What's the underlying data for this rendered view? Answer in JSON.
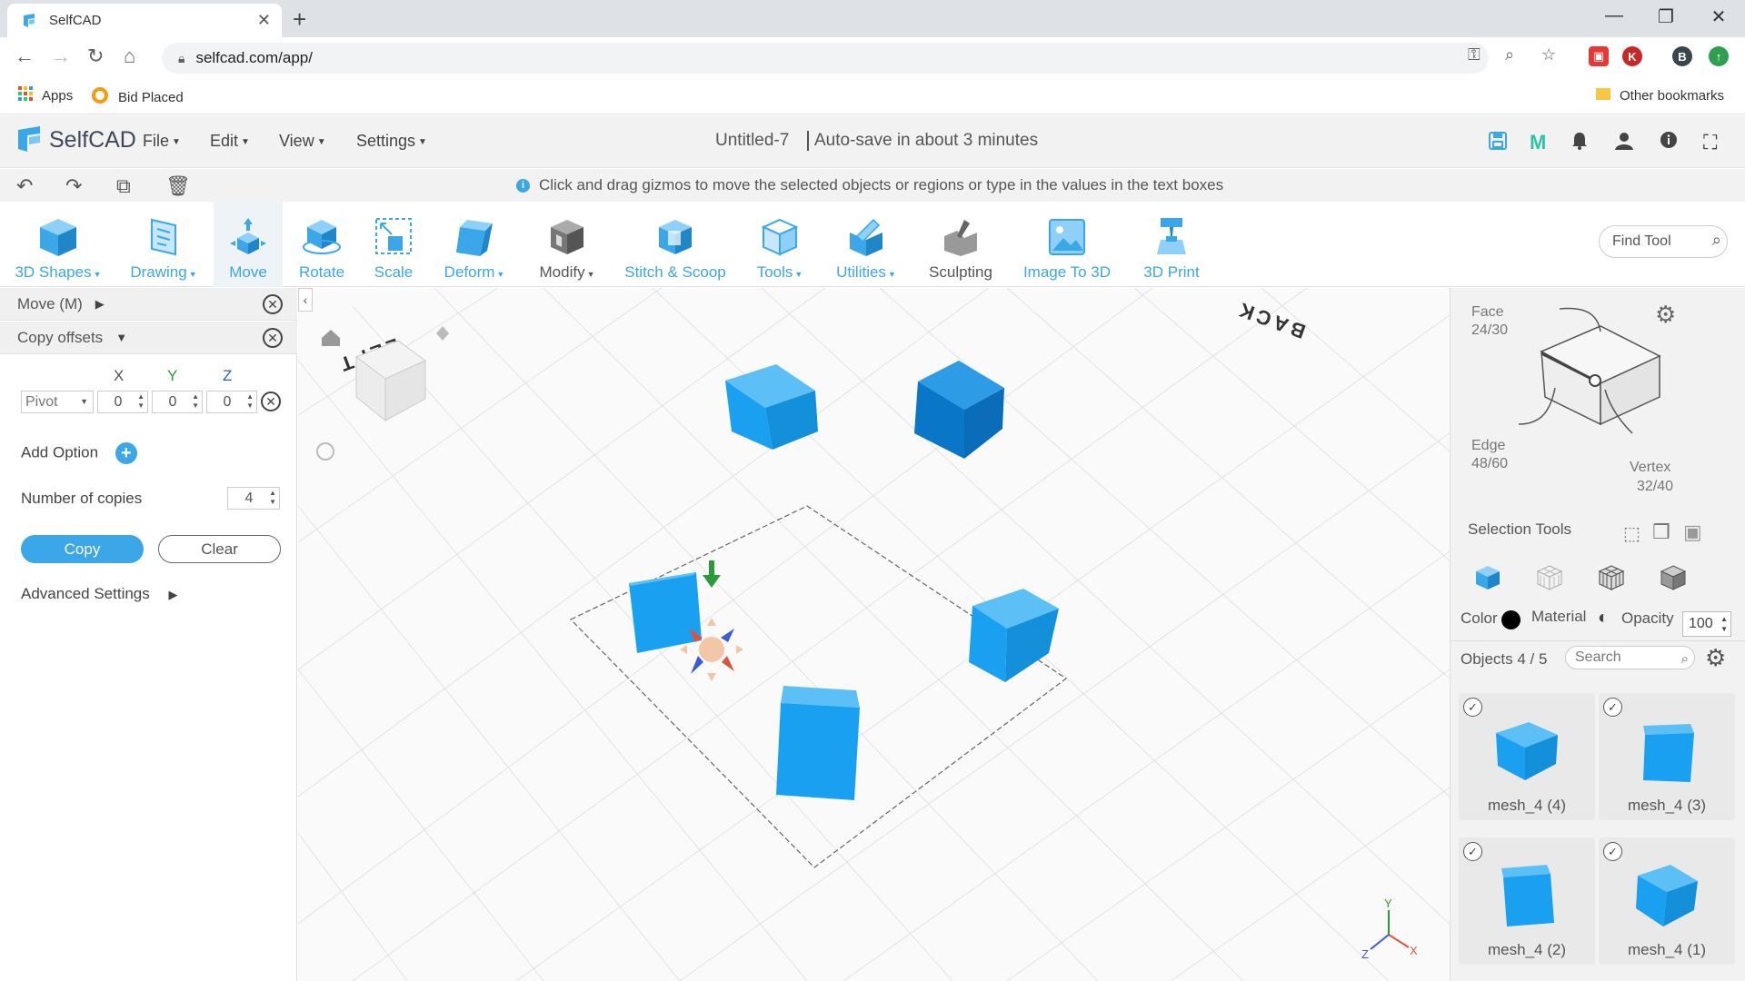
{
  "browser": {
    "tab_title": "SelfCAD",
    "tab_close": "✕",
    "new_tab": "+",
    "url": "selfcad.com/app/",
    "profile_initial": "B",
    "ext_k": "K",
    "bookmarks": {
      "apps": "Apps",
      "bid": "Bid Placed",
      "other": "Other bookmarks"
    }
  },
  "app": {
    "logo_text": "SelfCAD",
    "menus": [
      "File",
      "Edit",
      "View",
      "Settings"
    ],
    "doc_title": "Untitled-7",
    "autosave": "Auto-save in about 3 minutes",
    "hint": "Click and drag gizmos to move the selected objects or regions or type in the values in the text boxes"
  },
  "toolbar": {
    "tools": [
      {
        "label": "3D Shapes",
        "dropdown": true
      },
      {
        "label": "Drawing",
        "dropdown": true
      },
      {
        "label": "Move",
        "dropdown": false
      },
      {
        "label": "Rotate",
        "dropdown": false
      },
      {
        "label": "Scale",
        "dropdown": false
      },
      {
        "label": "Deform",
        "dropdown": true
      },
      {
        "label": "Modify",
        "dropdown": true
      },
      {
        "label": "Stitch & Scoop",
        "dropdown": false
      },
      {
        "label": "Tools",
        "dropdown": true
      },
      {
        "label": "Utilities",
        "dropdown": true
      },
      {
        "label": "Sculpting",
        "dropdown": false
      },
      {
        "label": "Image To 3D",
        "dropdown": false
      },
      {
        "label": "3D Print",
        "dropdown": false
      }
    ],
    "find_tool_placeholder": "Find Tool"
  },
  "left_panel": {
    "move_header": "Move (M)",
    "copy_offsets_header": "Copy offsets",
    "axes": {
      "x": "X",
      "y": "Y",
      "z": "Z"
    },
    "pivot": "Pivot",
    "x_value": "0",
    "y_value": "0",
    "z_value": "0",
    "add_option": "Add Option",
    "number_of_copies_label": "Number of copies",
    "number_of_copies": "4",
    "copy_button": "Copy",
    "clear_button": "Clear",
    "advanced_settings": "Advanced Settings"
  },
  "viewport": {
    "label_left": "LEFT",
    "label_back": "BACK",
    "axis_x": "X",
    "axis_y": "Y",
    "axis_z": "Z"
  },
  "right_panel": {
    "face_label": "Face",
    "face_count": "24/30",
    "edge_label": "Edge",
    "edge_count": "48/60",
    "vertex_label": "Vertex",
    "vertex_count": "32/40",
    "selection_tools": "Selection Tools",
    "color_label": "Color",
    "material_label": "Material",
    "opacity_label": "Opacity",
    "opacity_value": "100",
    "objects_label": "Objects 4 / 5",
    "search_placeholder": "Search",
    "objects": [
      {
        "name": "mesh_4 (4)"
      },
      {
        "name": "mesh_4 (3)"
      },
      {
        "name": "mesh_4 (2)"
      },
      {
        "name": "mesh_4 (1)"
      }
    ]
  },
  "colors": {
    "accent": "#3ba6e8",
    "cube": "#1aa0f0",
    "cube_dark": "#0a76c8"
  }
}
